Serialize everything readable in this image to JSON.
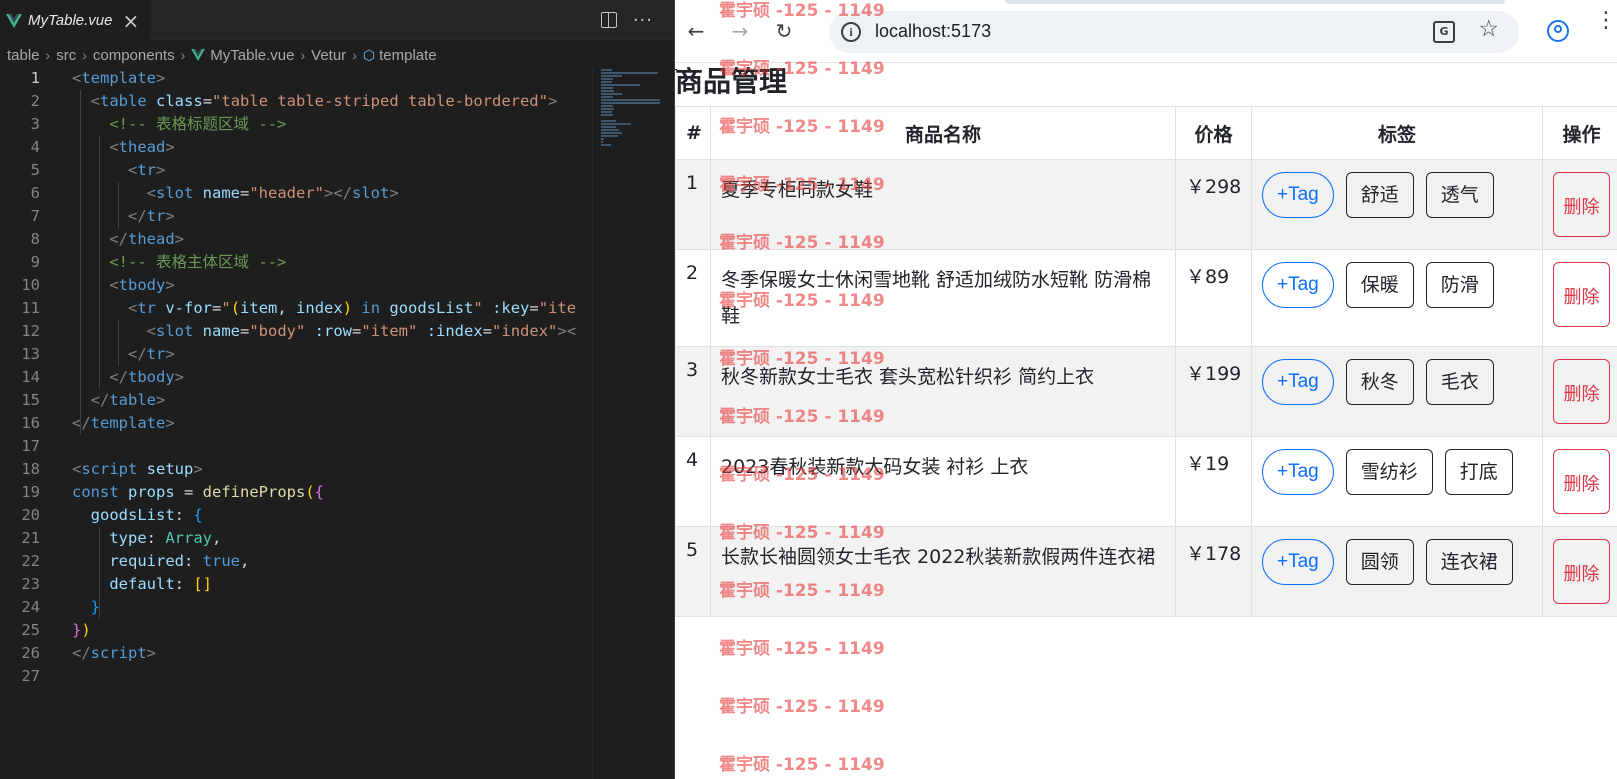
{
  "editor": {
    "tab_title": "MyTable.vue",
    "breadcrumb": [
      "table",
      "src",
      "components",
      "MyTable.vue",
      "Vetur",
      "template"
    ],
    "lines": [
      [
        [
          "k-br",
          "<"
        ],
        [
          "k-tag",
          "template"
        ],
        [
          "k-br",
          ">"
        ]
      ],
      [
        [
          "",
          "  "
        ],
        [
          "k-br",
          "<"
        ],
        [
          "k-tag",
          "table"
        ],
        [
          "",
          ""
        ],
        [
          "k-attr",
          " class"
        ],
        [
          "",
          "="
        ],
        [
          "k-str",
          "\"table table-striped table-bordered\""
        ],
        [
          "k-br",
          ">"
        ]
      ],
      [
        [
          "",
          "    "
        ],
        [
          "k-com",
          "<!-- 表格标题区域 -->"
        ]
      ],
      [
        [
          "",
          "    "
        ],
        [
          "k-br",
          "<"
        ],
        [
          "k-tag",
          "thead"
        ],
        [
          "k-br",
          ">"
        ]
      ],
      [
        [
          "",
          "      "
        ],
        [
          "k-br",
          "<"
        ],
        [
          "k-tag",
          "tr"
        ],
        [
          "k-br",
          ">"
        ]
      ],
      [
        [
          "",
          "        "
        ],
        [
          "k-br",
          "<"
        ],
        [
          "k-tag",
          "slot"
        ],
        [
          "k-attr",
          " name"
        ],
        [
          "",
          "="
        ],
        [
          "k-str",
          "\"header\""
        ],
        [
          "k-br",
          "></"
        ],
        [
          "k-tag",
          "slot"
        ],
        [
          "k-br",
          ">"
        ]
      ],
      [
        [
          "",
          "      "
        ],
        [
          "k-br",
          "</"
        ],
        [
          "k-tag",
          "tr"
        ],
        [
          "k-br",
          ">"
        ]
      ],
      [
        [
          "",
          "    "
        ],
        [
          "k-br",
          "</"
        ],
        [
          "k-tag",
          "thead"
        ],
        [
          "k-br",
          ">"
        ]
      ],
      [
        [
          "",
          "    "
        ],
        [
          "k-com",
          "<!-- 表格主体区域 -->"
        ]
      ],
      [
        [
          "",
          "    "
        ],
        [
          "k-br",
          "<"
        ],
        [
          "k-tag",
          "tbody"
        ],
        [
          "k-br",
          ">"
        ]
      ],
      [
        [
          "",
          "      "
        ],
        [
          "k-br",
          "<"
        ],
        [
          "k-tag",
          "tr"
        ],
        [
          "k-attr",
          " v-for"
        ],
        [
          "",
          "="
        ],
        [
          "k-str",
          "\""
        ],
        [
          "k-paren",
          "("
        ],
        [
          "k-attr",
          "item"
        ],
        [
          "",
          ", "
        ],
        [
          "k-attr",
          "index"
        ],
        [
          "k-paren",
          ")"
        ],
        [
          "k-kw",
          " in "
        ],
        [
          "k-attr",
          "goodsList"
        ],
        [
          "k-str",
          "\""
        ],
        [
          "k-attr",
          " :key"
        ],
        [
          "",
          "="
        ],
        [
          "k-str",
          "\"ite"
        ]
      ],
      [
        [
          "",
          "        "
        ],
        [
          "k-br",
          "<"
        ],
        [
          "k-tag",
          "slot"
        ],
        [
          "k-attr",
          " name"
        ],
        [
          "",
          "="
        ],
        [
          "k-str",
          "\"body\""
        ],
        [
          "k-attr",
          " :row"
        ],
        [
          "",
          "="
        ],
        [
          "k-str",
          "\"item\""
        ],
        [
          "k-attr",
          " :index"
        ],
        [
          "",
          "="
        ],
        [
          "k-str",
          "\"index\""
        ],
        [
          "k-br",
          "><"
        ]
      ],
      [
        [
          "",
          "      "
        ],
        [
          "k-br",
          "</"
        ],
        [
          "k-tag",
          "tr"
        ],
        [
          "k-br",
          ">"
        ]
      ],
      [
        [
          "",
          "    "
        ],
        [
          "k-br",
          "</"
        ],
        [
          "k-tag",
          "tbody"
        ],
        [
          "k-br",
          ">"
        ]
      ],
      [
        [
          "",
          "  "
        ],
        [
          "k-br",
          "</"
        ],
        [
          "k-tag",
          "table"
        ],
        [
          "k-br",
          ">"
        ]
      ],
      [
        [
          "k-br",
          "</"
        ],
        [
          "k-tag",
          "template"
        ],
        [
          "k-br",
          ">"
        ]
      ],
      [],
      [
        [
          "k-br",
          "<"
        ],
        [
          "k-tag",
          "script"
        ],
        [
          "k-attr",
          " setup"
        ],
        [
          "k-br",
          ">"
        ]
      ],
      [
        [
          "k-kw",
          "const "
        ],
        [
          "k-attr",
          "props"
        ],
        [
          "",
          " = "
        ],
        [
          "k-fn",
          "defineProps"
        ],
        [
          "k-paren",
          "("
        ],
        [
          "k-paren2",
          "{"
        ]
      ],
      [
        [
          "",
          "  "
        ],
        [
          "k-attr",
          "goodsList"
        ],
        [
          "",
          ": "
        ],
        [
          "k-paren3",
          "{"
        ]
      ],
      [
        [
          "",
          "    "
        ],
        [
          "k-attr",
          "type"
        ],
        [
          "",
          ": "
        ],
        [
          "k-ty",
          "Array"
        ],
        [
          "",
          ","
        ]
      ],
      [
        [
          "",
          "    "
        ],
        [
          "k-attr",
          "required"
        ],
        [
          "",
          ": "
        ],
        [
          "k-kw",
          "true"
        ],
        [
          "",
          ","
        ]
      ],
      [
        [
          "",
          "    "
        ],
        [
          "k-attr",
          "default"
        ],
        [
          "",
          ": "
        ],
        [
          "k-paren",
          "[]"
        ]
      ],
      [
        [
          "",
          "  "
        ],
        [
          "k-paren3",
          "}"
        ]
      ],
      [
        [
          "k-paren2",
          "}"
        ],
        [
          "k-paren",
          ")"
        ]
      ],
      [
        [
          "k-br",
          "</"
        ],
        [
          "k-tag",
          "script"
        ],
        [
          "k-br",
          ">"
        ]
      ],
      []
    ]
  },
  "browser": {
    "url": "localhost:5173",
    "translate_label": "G"
  },
  "page": {
    "title": "商品管理",
    "columns": [
      "#",
      "商品名称",
      "价格",
      "标签",
      "操作"
    ],
    "add_tag_label": "+Tag",
    "delete_label": "删除",
    "rows": [
      {
        "index": "1",
        "name": "夏季专柜同款女鞋",
        "price": "￥298",
        "tags": [
          "舒适",
          "透气"
        ]
      },
      {
        "index": "2",
        "name": "冬季保暖女士休闲雪地靴 舒适加绒防水短靴 防滑棉鞋",
        "price": "￥89",
        "tags": [
          "保暖",
          "防滑"
        ]
      },
      {
        "index": "3",
        "name": "秋冬新款女士毛衣 套头宽松针织衫 简约上衣",
        "price": "￥199",
        "tags": [
          "秋冬",
          "毛衣"
        ]
      },
      {
        "index": "4",
        "name": "2023春秋装新款大码女装 衬衫 上衣",
        "price": "￥19",
        "tags": [
          "雪纺衫",
          "打底"
        ]
      },
      {
        "index": "5",
        "name": "长款长袖圆领女士毛衣 2022秋装新款假两件连衣裙",
        "price": "￥178",
        "tags": [
          "圆领",
          "连衣裙"
        ]
      }
    ]
  },
  "watermark": "霍宇硕 -125 - 1149"
}
